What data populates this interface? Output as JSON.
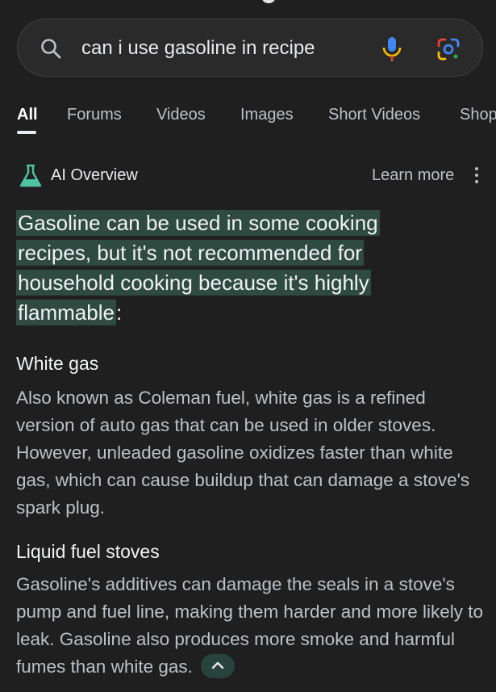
{
  "search": {
    "query": "can i use gasoline in recipe"
  },
  "tabs": [
    {
      "label": "All",
      "active": true
    },
    {
      "label": "Forums"
    },
    {
      "label": "Videos"
    },
    {
      "label": "Images"
    },
    {
      "label": "Short Videos"
    },
    {
      "label": "Shop"
    }
  ],
  "ai_overview": {
    "title": "AI Overview",
    "learn_more": "Learn more",
    "summary_highlight": "Gasoline can be used in some cooking recipes, but it's not recommended for household cooking because it's highly flammable",
    "summary_suffix": ":",
    "sections": [
      {
        "heading": "White gas",
        "body": "Also known as Coleman fuel, white gas is a refined version of auto gas that can be used in older stoves. However, unleaded gasoline oxidizes faster than white gas, which can cause buildup that can damage a stove's spark plug."
      },
      {
        "heading": "Liquid fuel stoves",
        "body": "Gasoline's additives can damage the seals in a stove's pump and fuel line, making them harder and more likely to leak. Gasoline also produces more smoke and harmful fumes than white gas."
      }
    ]
  },
  "icons": {
    "search": "search-icon",
    "mic": "mic-icon",
    "lens": "google-lens-icon",
    "flask": "flask-icon",
    "more": "more-vert-icon",
    "collapse": "chevron-up-icon"
  },
  "colors": {
    "background": "#1f1f1f",
    "highlight": "#2f4a41",
    "accent_teal": "#4fc3a1",
    "mic_blue": "#4285f4",
    "mic_yellow": "#fbbc04"
  }
}
